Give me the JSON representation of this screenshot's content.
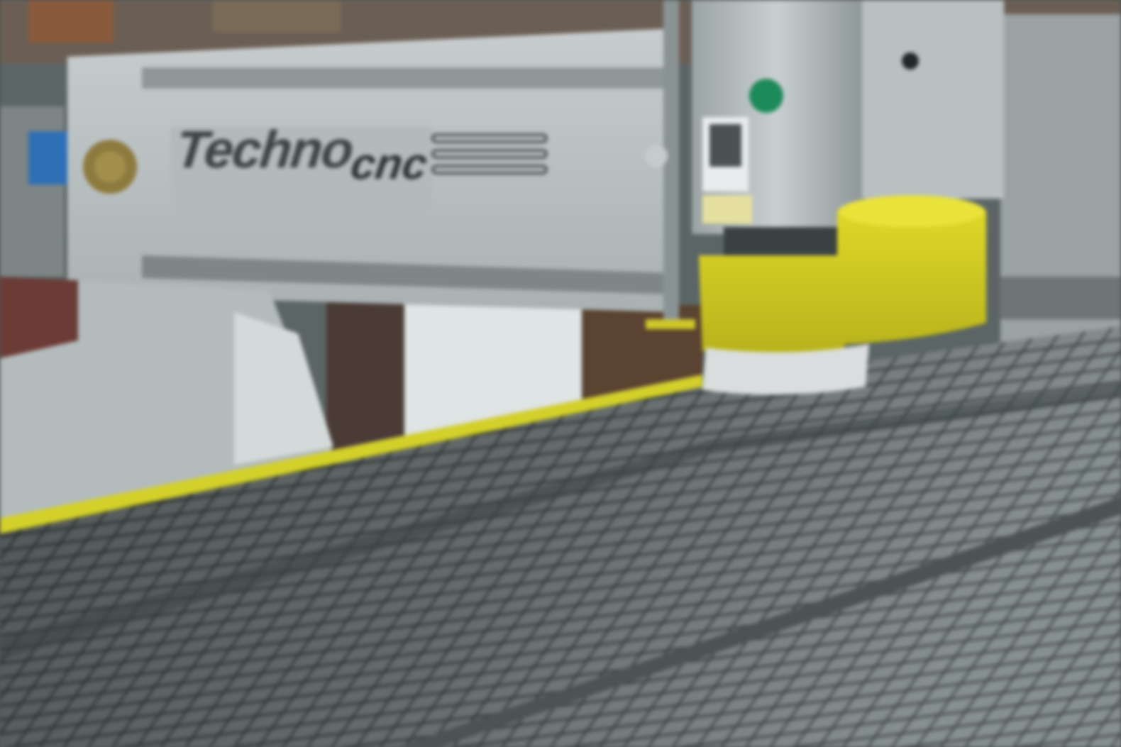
{
  "machine": {
    "brand_logo": "Techno",
    "brand_logo_suffix": "cnc"
  },
  "colors": {
    "gantry": "#b8bfc0",
    "table": "#7c8585",
    "grid_lines": "#3f4748",
    "dust_shoe": "#d6d21f",
    "edge_stripe": "#d3d02a",
    "background": "#4e5656"
  }
}
